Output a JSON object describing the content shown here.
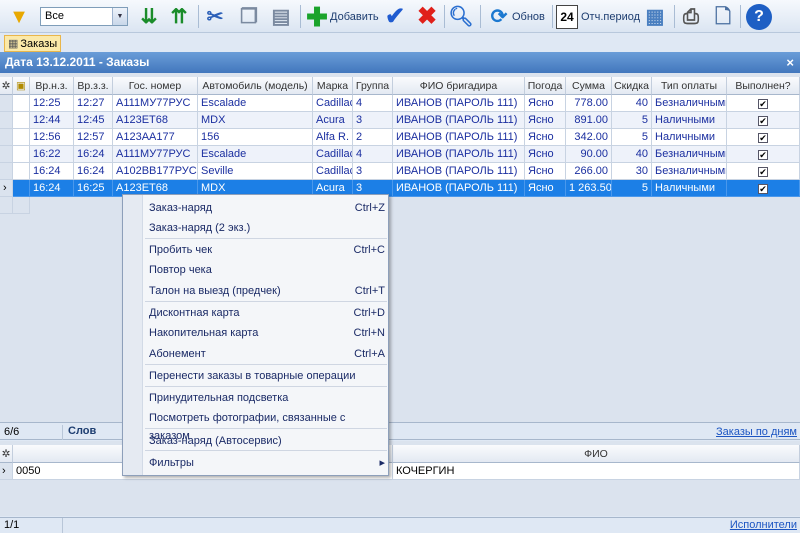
{
  "toolbar": {
    "filter_value": "Все",
    "add_label": "Добавить",
    "refresh_label": "Обнов",
    "period_label": "Отч.период",
    "calendar_day": "24"
  },
  "tab": {
    "label": "Заказы"
  },
  "window": {
    "title": "Дата 13.12.2011 - Заказы",
    "close": "×"
  },
  "columns": [
    "Вр.н.з.",
    "Вр.з.з.",
    "Гос. номер",
    "Автомобиль (модель)",
    "Марка",
    "Группа",
    "ФИО бригадира",
    "Погода",
    "Сумма",
    "Скидка",
    "Тип оплаты",
    "Выполнен?"
  ],
  "rows": [
    [
      "12:25",
      "12:27",
      "А111МУ77РУС",
      "Escalade",
      "Cadillac",
      "4",
      "ИВАНОВ (ПАРОЛЬ 111)",
      "Ясно",
      "778.00",
      "40",
      "Безналичными",
      "✔"
    ],
    [
      "12:44",
      "12:45",
      "А123ЕТ68",
      "MDX",
      "Acura",
      "3",
      "ИВАНОВ (ПАРОЛЬ 111)",
      "Ясно",
      "891.00",
      "5",
      "Наличными",
      "✔"
    ],
    [
      "12:56",
      "12:57",
      "А123АА177",
      "156",
      "Alfa R.",
      "2",
      "ИВАНОВ (ПАРОЛЬ 111)",
      "Ясно",
      "342.00",
      "5",
      "Наличными",
      "✔"
    ],
    [
      "16:22",
      "16:24",
      "А111МУ77РУС",
      "Escalade",
      "Cadillac",
      "4",
      "ИВАНОВ (ПАРОЛЬ 111)",
      "Ясно",
      "90.00",
      "40",
      "Безналичными",
      "✔"
    ],
    [
      "16:24",
      "16:24",
      "А102ВВ177РУС",
      "Seville",
      "Cadillac",
      "3",
      "ИВАНОВ (ПАРОЛЬ 111)",
      "Ясно",
      "266.00",
      "30",
      "Безналичными",
      "✔"
    ],
    [
      "16:24",
      "16:25",
      "А123ЕТ68",
      "MDX",
      "Acura",
      "3",
      "ИВАНОВ (ПАРОЛЬ 111)",
      "Ясно",
      "1 263.50",
      "5",
      "Наличными",
      "✔"
    ]
  ],
  "status": {
    "count": "6/6",
    "words": "Слов",
    "link": "Заказы по дням"
  },
  "menu": [
    {
      "label": "Заказ-наряд",
      "shortcut": "Ctrl+Z"
    },
    {
      "label": "Заказ-наряд (2 экз.)",
      "shortcut": ""
    },
    {
      "label": "Пробить чек",
      "shortcut": "Ctrl+C"
    },
    {
      "label": "Повтор чека",
      "shortcut": ""
    },
    {
      "label": "Талон на выезд (предчек)",
      "shortcut": "Ctrl+T"
    },
    {
      "label": "Дисконтная карта",
      "shortcut": "Ctrl+D"
    },
    {
      "label": "Накопительная карта",
      "shortcut": "Ctrl+N"
    },
    {
      "label": "Абонемент",
      "shortcut": "Ctrl+A"
    },
    {
      "label": "Перенести заказы в товарные операции",
      "shortcut": ""
    },
    {
      "label": "Принудительная подсветка",
      "shortcut": ""
    },
    {
      "label": "Посмотреть фотографии, связанные с заказом",
      "shortcut": ""
    },
    {
      "label": "Заказ-наряд (Автосервис)",
      "shortcut": ""
    },
    {
      "label": "Фильтры",
      "shortcut": "▸"
    }
  ],
  "grid2": {
    "fio_header": "ФИО",
    "code": "0050",
    "fio": "КОЧЕРГИН"
  },
  "status2": {
    "count": "1/1",
    "link": "Исполнители"
  }
}
